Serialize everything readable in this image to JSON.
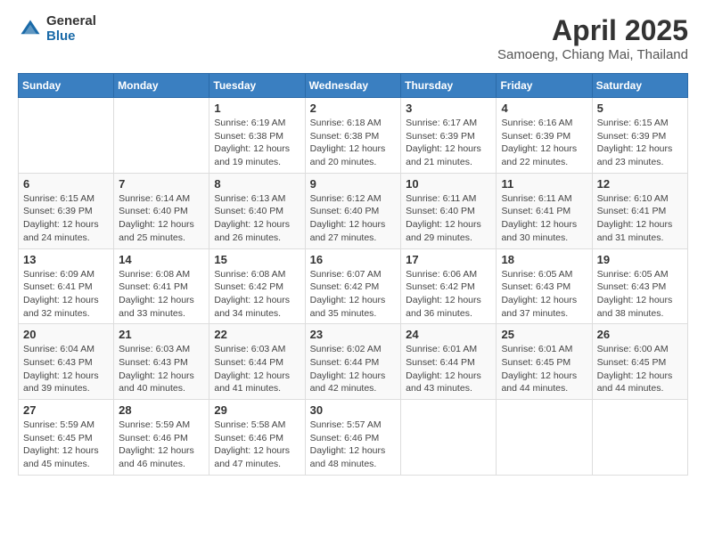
{
  "header": {
    "logo_general": "General",
    "logo_blue": "Blue",
    "title": "April 2025",
    "location": "Samoeng, Chiang Mai, Thailand"
  },
  "days_of_week": [
    "Sunday",
    "Monday",
    "Tuesday",
    "Wednesday",
    "Thursday",
    "Friday",
    "Saturday"
  ],
  "weeks": [
    [
      {
        "day": "",
        "info": ""
      },
      {
        "day": "",
        "info": ""
      },
      {
        "day": "1",
        "info": "Sunrise: 6:19 AM\nSunset: 6:38 PM\nDaylight: 12 hours and 19 minutes."
      },
      {
        "day": "2",
        "info": "Sunrise: 6:18 AM\nSunset: 6:38 PM\nDaylight: 12 hours and 20 minutes."
      },
      {
        "day": "3",
        "info": "Sunrise: 6:17 AM\nSunset: 6:39 PM\nDaylight: 12 hours and 21 minutes."
      },
      {
        "day": "4",
        "info": "Sunrise: 6:16 AM\nSunset: 6:39 PM\nDaylight: 12 hours and 22 minutes."
      },
      {
        "day": "5",
        "info": "Sunrise: 6:15 AM\nSunset: 6:39 PM\nDaylight: 12 hours and 23 minutes."
      }
    ],
    [
      {
        "day": "6",
        "info": "Sunrise: 6:15 AM\nSunset: 6:39 PM\nDaylight: 12 hours and 24 minutes."
      },
      {
        "day": "7",
        "info": "Sunrise: 6:14 AM\nSunset: 6:40 PM\nDaylight: 12 hours and 25 minutes."
      },
      {
        "day": "8",
        "info": "Sunrise: 6:13 AM\nSunset: 6:40 PM\nDaylight: 12 hours and 26 minutes."
      },
      {
        "day": "9",
        "info": "Sunrise: 6:12 AM\nSunset: 6:40 PM\nDaylight: 12 hours and 27 minutes."
      },
      {
        "day": "10",
        "info": "Sunrise: 6:11 AM\nSunset: 6:40 PM\nDaylight: 12 hours and 29 minutes."
      },
      {
        "day": "11",
        "info": "Sunrise: 6:11 AM\nSunset: 6:41 PM\nDaylight: 12 hours and 30 minutes."
      },
      {
        "day": "12",
        "info": "Sunrise: 6:10 AM\nSunset: 6:41 PM\nDaylight: 12 hours and 31 minutes."
      }
    ],
    [
      {
        "day": "13",
        "info": "Sunrise: 6:09 AM\nSunset: 6:41 PM\nDaylight: 12 hours and 32 minutes."
      },
      {
        "day": "14",
        "info": "Sunrise: 6:08 AM\nSunset: 6:41 PM\nDaylight: 12 hours and 33 minutes."
      },
      {
        "day": "15",
        "info": "Sunrise: 6:08 AM\nSunset: 6:42 PM\nDaylight: 12 hours and 34 minutes."
      },
      {
        "day": "16",
        "info": "Sunrise: 6:07 AM\nSunset: 6:42 PM\nDaylight: 12 hours and 35 minutes."
      },
      {
        "day": "17",
        "info": "Sunrise: 6:06 AM\nSunset: 6:42 PM\nDaylight: 12 hours and 36 minutes."
      },
      {
        "day": "18",
        "info": "Sunrise: 6:05 AM\nSunset: 6:43 PM\nDaylight: 12 hours and 37 minutes."
      },
      {
        "day": "19",
        "info": "Sunrise: 6:05 AM\nSunset: 6:43 PM\nDaylight: 12 hours and 38 minutes."
      }
    ],
    [
      {
        "day": "20",
        "info": "Sunrise: 6:04 AM\nSunset: 6:43 PM\nDaylight: 12 hours and 39 minutes."
      },
      {
        "day": "21",
        "info": "Sunrise: 6:03 AM\nSunset: 6:43 PM\nDaylight: 12 hours and 40 minutes."
      },
      {
        "day": "22",
        "info": "Sunrise: 6:03 AM\nSunset: 6:44 PM\nDaylight: 12 hours and 41 minutes."
      },
      {
        "day": "23",
        "info": "Sunrise: 6:02 AM\nSunset: 6:44 PM\nDaylight: 12 hours and 42 minutes."
      },
      {
        "day": "24",
        "info": "Sunrise: 6:01 AM\nSunset: 6:44 PM\nDaylight: 12 hours and 43 minutes."
      },
      {
        "day": "25",
        "info": "Sunrise: 6:01 AM\nSunset: 6:45 PM\nDaylight: 12 hours and 44 minutes."
      },
      {
        "day": "26",
        "info": "Sunrise: 6:00 AM\nSunset: 6:45 PM\nDaylight: 12 hours and 44 minutes."
      }
    ],
    [
      {
        "day": "27",
        "info": "Sunrise: 5:59 AM\nSunset: 6:45 PM\nDaylight: 12 hours and 45 minutes."
      },
      {
        "day": "28",
        "info": "Sunrise: 5:59 AM\nSunset: 6:46 PM\nDaylight: 12 hours and 46 minutes."
      },
      {
        "day": "29",
        "info": "Sunrise: 5:58 AM\nSunset: 6:46 PM\nDaylight: 12 hours and 47 minutes."
      },
      {
        "day": "30",
        "info": "Sunrise: 5:57 AM\nSunset: 6:46 PM\nDaylight: 12 hours and 48 minutes."
      },
      {
        "day": "",
        "info": ""
      },
      {
        "day": "",
        "info": ""
      },
      {
        "day": "",
        "info": ""
      }
    ]
  ]
}
